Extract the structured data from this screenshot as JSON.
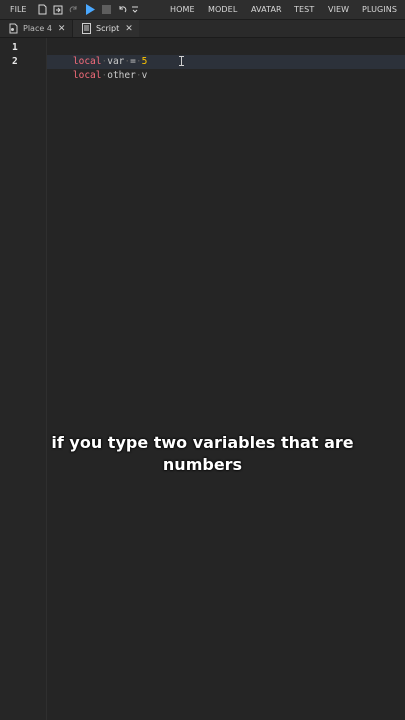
{
  "menubar": {
    "file_label": "FILE",
    "tabs": [
      "HOME",
      "MODEL",
      "AVATAR",
      "TEST",
      "VIEW",
      "PLUGINS"
    ]
  },
  "icons": {
    "new": "new-file-icon",
    "open": "open-icon",
    "redo": "redo-icon",
    "play": "play-icon",
    "stop": "stop-icon",
    "undo": "undo-icon",
    "more": "chevron-down-icon"
  },
  "colors": {
    "accent_play": "#4aa8ff",
    "keyword": "#f86d7c",
    "number": "#ffc600"
  },
  "tabs": {
    "place_label": "Place 4",
    "script_label": "Script",
    "close_glyph": "✕"
  },
  "editor": {
    "lines": [
      {
        "num": "1",
        "kw": "local",
        "name": "var",
        "op": "=",
        "value": "5"
      },
      {
        "num": "2",
        "kw": "local",
        "name": "other",
        "rest": "v"
      }
    ],
    "whitespace_dot": "·"
  },
  "caption": {
    "line1": "if you type two variables that are",
    "line2": "numbers"
  }
}
